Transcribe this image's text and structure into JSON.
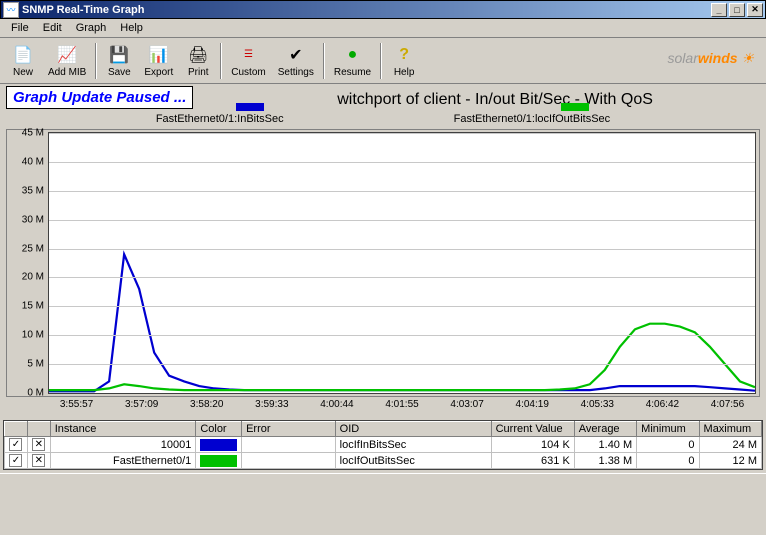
{
  "window": {
    "title": "SNMP Real-Time Graph"
  },
  "menu": [
    "File",
    "Edit",
    "Graph",
    "Help"
  ],
  "toolbar": {
    "new": "New",
    "addmib": "Add MIB",
    "save": "Save",
    "export": "Export",
    "print": "Print",
    "custom": "Custom",
    "settings": "Settings",
    "resume": "Resume",
    "help": "Help"
  },
  "brand": {
    "part1": "solar",
    "part2": "winds"
  },
  "banner": "Graph Update Paused ...",
  "chart_title_full": "Switchport of client - In/out Bit/Sec - With QoS",
  "chart_title_visible_suffix": "witchport of client - In/out Bit/Sec - With QoS",
  "legend": {
    "s1": {
      "label": "FastEthernet0/1:InBitsSec",
      "color": "#0000d0"
    },
    "s2": {
      "label": "FastEthernet0/1:locIfOutBitsSec",
      "color": "#00c000"
    }
  },
  "chart_data": {
    "type": "line",
    "xlabel": "",
    "ylabel": "",
    "ylim": [
      0,
      45
    ],
    "y_unit": "M",
    "x_categories": [
      "3:55:57",
      "3:57:09",
      "3:58:20",
      "3:59:33",
      "4:00:44",
      "4:01:55",
      "4:03:07",
      "4:04:19",
      "4:05:33",
      "4:06:42",
      "4:07:56"
    ],
    "y_ticks": [
      0,
      5,
      10,
      15,
      20,
      25,
      30,
      35,
      40,
      45
    ],
    "series": [
      {
        "name": "FastEthernet0/1:InBitsSec",
        "color": "#0000d0",
        "values_M": [
          0.3,
          0.3,
          0.3,
          0.3,
          2,
          24,
          18,
          7,
          3,
          2,
          1.2,
          0.8,
          0.6,
          0.5,
          0.5,
          0.5,
          0.5,
          0.5,
          0.5,
          0.5,
          0.5,
          0.5,
          0.5,
          0.5,
          0.5,
          0.5,
          0.5,
          0.5,
          0.5,
          0.5,
          0.5,
          0.5,
          0.5,
          0.5,
          0.5,
          0.5,
          0.5,
          0.8,
          1.2,
          1.2,
          1.2,
          1.2,
          1.2,
          1.2,
          1.0,
          0.8,
          0.6,
          0.4
        ]
      },
      {
        "name": "FastEthernet0/1:locIfOutBitsSec",
        "color": "#00c000",
        "values_M": [
          0.5,
          0.5,
          0.5,
          0.5,
          0.8,
          1.5,
          1.2,
          0.8,
          0.6,
          0.5,
          0.5,
          0.5,
          0.5,
          0.5,
          0.5,
          0.5,
          0.5,
          0.5,
          0.5,
          0.5,
          0.5,
          0.5,
          0.5,
          0.5,
          0.5,
          0.5,
          0.5,
          0.5,
          0.5,
          0.5,
          0.5,
          0.5,
          0.5,
          0.5,
          0.6,
          0.8,
          1.5,
          4,
          8,
          11,
          12,
          12,
          11.5,
          10.5,
          8,
          5,
          2,
          1
        ]
      }
    ]
  },
  "table": {
    "headers": {
      "instance": "Instance",
      "color": "Color",
      "error": "Error",
      "oid": "OID",
      "current": "Current Value",
      "avg": "Average",
      "min": "Minimum",
      "max": "Maximum"
    },
    "rows": [
      {
        "checked": true,
        "x": "✕",
        "instance": "10001",
        "color": "#0000d0",
        "error": "",
        "oid": "locIfInBitsSec",
        "current": "104 K",
        "avg": "1.40 M",
        "min": "0",
        "max": "24 M"
      },
      {
        "checked": true,
        "x": "✕",
        "instance": "FastEthernet0/1",
        "color": "#00c000",
        "error": "",
        "oid": "locIfOutBitsSec",
        "current": "631 K",
        "avg": "1.38 M",
        "min": "0",
        "max": "12 M"
      }
    ]
  }
}
